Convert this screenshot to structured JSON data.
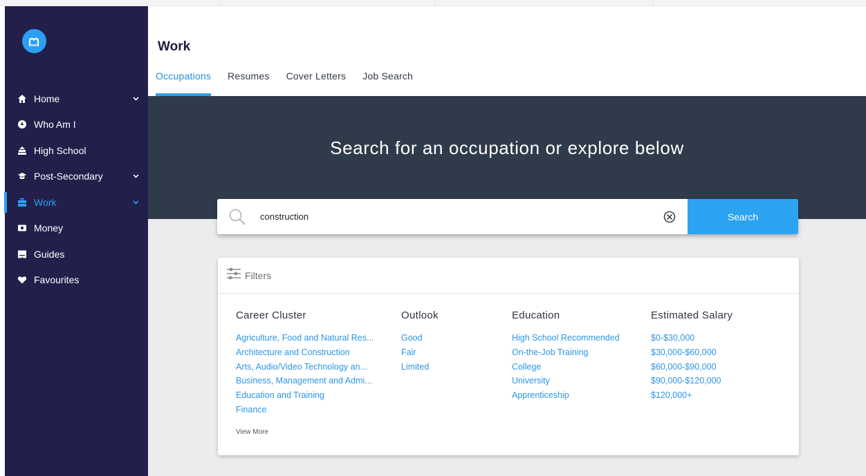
{
  "nav": {
    "items": [
      {
        "label": "Home",
        "icon": "home-icon",
        "has_chevron": true
      },
      {
        "label": "Who Am I",
        "icon": "compass-icon",
        "has_chevron": false
      },
      {
        "label": "High School",
        "icon": "school-icon",
        "has_chevron": false
      },
      {
        "label": "Post-Secondary",
        "icon": "graduation-cap-icon",
        "has_chevron": true
      },
      {
        "label": "Work",
        "icon": "briefcase-icon",
        "has_chevron": true,
        "active": true
      },
      {
        "label": "Money",
        "icon": "money-icon",
        "has_chevron": false
      },
      {
        "label": "Guides",
        "icon": "book-icon",
        "has_chevron": false
      },
      {
        "label": "Favourites",
        "icon": "heart-icon",
        "has_chevron": false
      }
    ]
  },
  "header": {
    "title": "Work",
    "tabs": [
      {
        "label": "Occupations",
        "active": true
      },
      {
        "label": "Resumes"
      },
      {
        "label": "Cover Letters"
      },
      {
        "label": "Job Search"
      }
    ]
  },
  "hero": {
    "title": "Search for an occupation or explore below"
  },
  "search": {
    "value": "construction",
    "button_label": "Search"
  },
  "filters": {
    "label": "Filters",
    "columns": [
      {
        "title": "Career Cluster",
        "items": [
          "Agriculture, Food and Natural Res...",
          "Architecture and Construction",
          "Arts, Audio/Video Technology an...",
          "Business, Management and Admi...",
          "Education and Training",
          "Finance"
        ]
      },
      {
        "title": "Outlook",
        "items": [
          "Good",
          "Fair",
          "Limited"
        ]
      },
      {
        "title": "Education",
        "items": [
          "High School Recommended",
          "On-the-Job Training",
          "College",
          "University",
          "Apprenticeship"
        ]
      },
      {
        "title": "Estimated Salary",
        "items": [
          "$0-$30,000",
          "$30,000-$60,000",
          "$60,000-$90,000",
          "$90,000-$120,000",
          "$120,000+"
        ]
      }
    ],
    "view_more": "View More"
  },
  "colors": {
    "sidebar": "#221f4b",
    "accent": "#2b9ff2",
    "hero": "#2f3b4b"
  }
}
